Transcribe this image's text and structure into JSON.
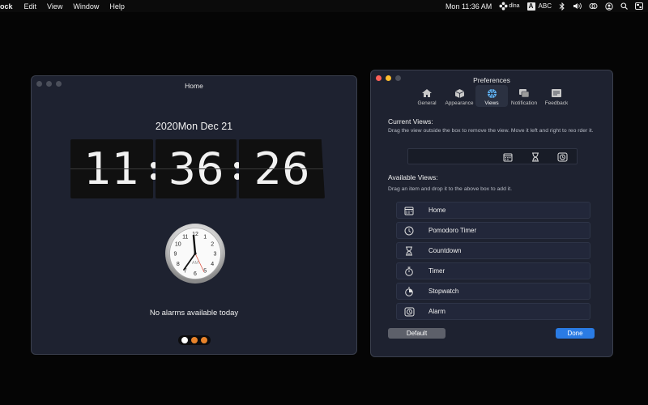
{
  "menubar": {
    "app": "ock",
    "items": [
      "Edit",
      "View",
      "Window",
      "Help"
    ],
    "clock": "Mon 11:36 AM",
    "status_label": "dlna",
    "ime_box": "A",
    "ime_label": "ABC"
  },
  "home": {
    "title": "Home",
    "date": "2020Mon Dec 21",
    "time": {
      "hours": "11",
      "minutes": "36",
      "seconds": "26"
    },
    "analog_label": "AM",
    "analog_numbers": [
      "12",
      "1",
      "2",
      "3",
      "4",
      "5",
      "6",
      "7",
      "8",
      "9",
      "10",
      "11"
    ],
    "alarms_text": "No alarms available today",
    "pager_colors": [
      "#ffffff",
      "#e8832b",
      "#e8832b"
    ]
  },
  "prefs": {
    "title": "Preferences",
    "tabs": [
      {
        "label": "General",
        "icon": "house-icon"
      },
      {
        "label": "Appearance",
        "icon": "cube-icon"
      },
      {
        "label": "Views",
        "icon": "globe-icon",
        "active": true
      },
      {
        "label": "Notification",
        "icon": "notification-icon"
      },
      {
        "label": "Feedback",
        "icon": "feedback-icon"
      }
    ],
    "current_title": "Current Views:",
    "current_desc": "Drag the view outside the box to remove the view. Move it left and right to reo rder it.",
    "available_title": "Available Views:",
    "available_desc": "Drag an item and drop it to the above box to add it.",
    "available_items": [
      {
        "label": "Home",
        "icon": "calendar-icon"
      },
      {
        "label": "Pomodoro Timer",
        "icon": "pomodoro-icon"
      },
      {
        "label": "Countdown",
        "icon": "hourglass-icon"
      },
      {
        "label": "Timer",
        "icon": "timer-icon"
      },
      {
        "label": "Stopwatch",
        "icon": "stopwatch-icon"
      },
      {
        "label": "Alarm",
        "icon": "alarm-icon"
      }
    ],
    "default_button": "Default",
    "done_button": "Done"
  },
  "colors": {
    "close": "#fe5f57",
    "minimize": "#febc2e",
    "zoom_inactive": "#4b4f5a",
    "accent": "#2a7be4",
    "window_bg": "#1e2230"
  }
}
